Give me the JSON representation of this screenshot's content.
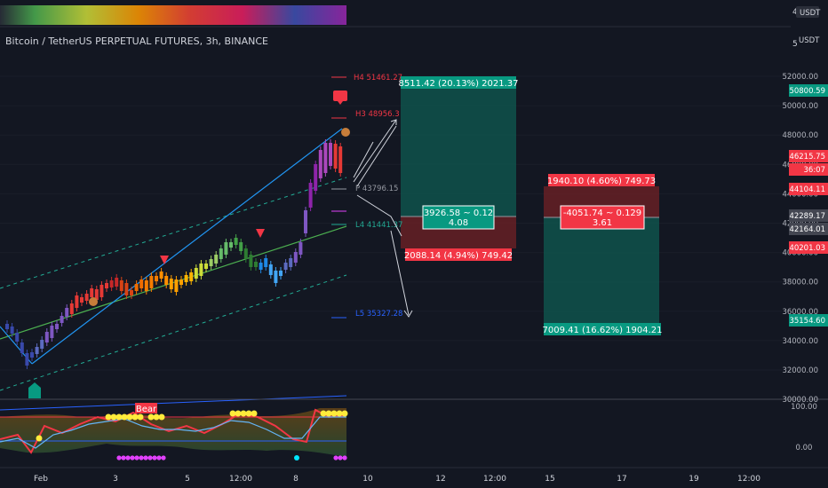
{
  "header": {
    "title": "Bitcoin / TetherUS PERPETUAL FUTURES, 3h, BINANCE",
    "top_scale_value": "4",
    "currency_top": "USDT",
    "currency_main": "USDT",
    "scale_mark": "5"
  },
  "price_axis": {
    "ticks": [
      "52000.00",
      "50000.00",
      "48000.00",
      "46000.00",
      "44000.00",
      "42000.00",
      "40000.00",
      "38000.00",
      "36000.00",
      "34000.00",
      "32000.00",
      "30000.00"
    ],
    "labels": [
      {
        "text": "50800.59",
        "color": "#089981"
      },
      {
        "text": "46215.75",
        "color": "#f23645"
      },
      {
        "text": "36:07",
        "color": "#f23645"
      },
      {
        "text": "44104.11",
        "color": "#f23645"
      },
      {
        "text": "42289.17",
        "color": "#434651"
      },
      {
        "text": "42164.01",
        "color": "#434651"
      },
      {
        "text": "40201.03",
        "color": "#f23645"
      },
      {
        "text": "35154.60",
        "color": "#089981"
      }
    ]
  },
  "osc_axis": {
    "ticks": [
      "100.00",
      "0.00"
    ]
  },
  "time_axis": {
    "ticks": [
      "Feb",
      "3",
      "5",
      "12:00",
      "8",
      "10",
      "12",
      "12:00",
      "15",
      "17",
      "19",
      "12:00"
    ]
  },
  "levels": [
    {
      "text": "H4 51461.27",
      "color": "#f23645"
    },
    {
      "text": "H3 48956.3",
      "color": "#f23645"
    },
    {
      "text": "P 43796.15",
      "color": "#9598a1"
    },
    {
      "text": "L4 41441.37",
      "color": "#22ab94"
    },
    {
      "text": "L5 35327.28",
      "color": "#2962ff"
    }
  ],
  "position_long": {
    "target": "8511.42 (20.13%) 2021.37",
    "center_line1": "3926.58 ~ 0.12",
    "center_line2": "4.08",
    "stop": "2088.14 (4.94%) 749.42"
  },
  "position_short": {
    "stop": "1940.10 (4.60%) 749.73",
    "center_line1": "-4051.74 ~ 0.129",
    "center_line2": "3.61",
    "target": "7009.41 (16.62%) 1904.21"
  },
  "osc_label": "Bear",
  "colors": {
    "bg": "#131722",
    "up": "#089981",
    "down": "#f23645",
    "blue": "#2962ff"
  }
}
